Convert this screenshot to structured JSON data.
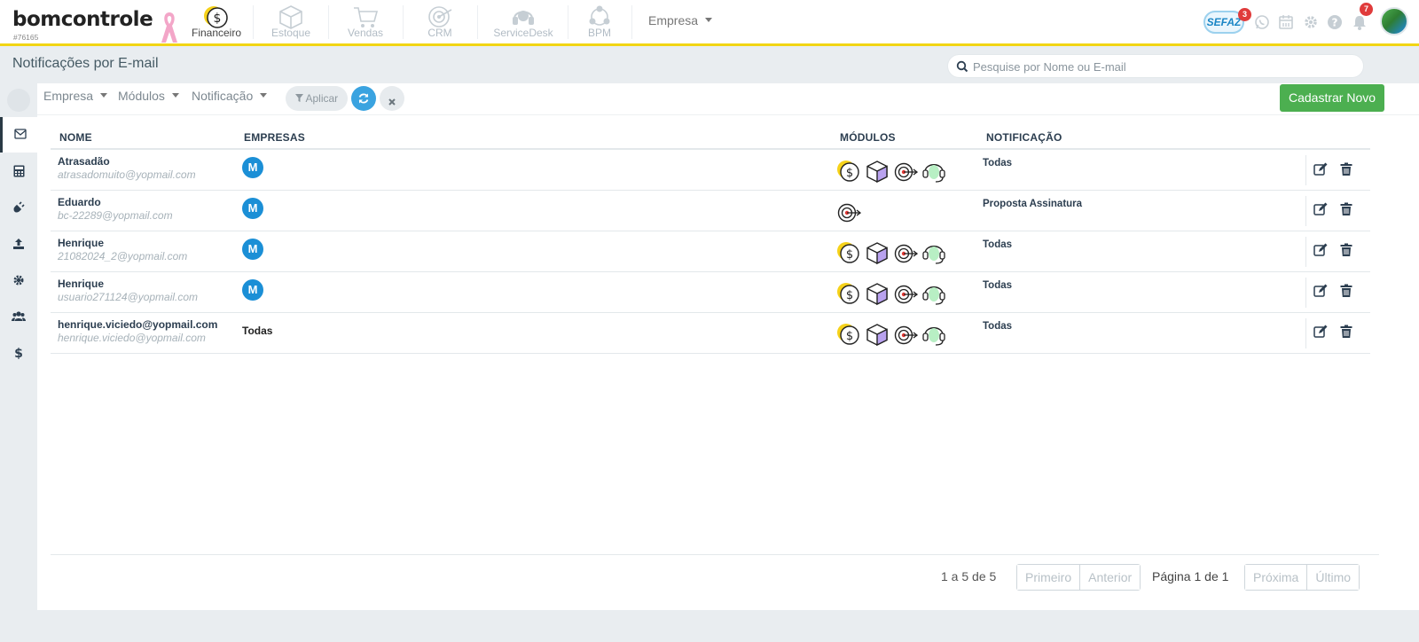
{
  "app": {
    "logo_text": "bomcontrole",
    "account_id": "#76165"
  },
  "topnav": {
    "modules": [
      {
        "label": "Financeiro",
        "icon": "coin-dollar-icon",
        "active": true
      },
      {
        "label": "Estoque",
        "icon": "box-icon",
        "active": false
      },
      {
        "label": "Vendas",
        "icon": "cart-icon",
        "active": false
      },
      {
        "label": "CRM",
        "icon": "target-icon",
        "active": false
      },
      {
        "label": "ServiceDesk",
        "icon": "headset-icon",
        "active": false
      },
      {
        "label": "BPM",
        "icon": "process-icon",
        "active": false
      }
    ],
    "empresa_label": "Empresa",
    "sefaz_label": "SEFAZ",
    "sefaz_badge": "3",
    "notifications_badge": "7"
  },
  "page": {
    "title": "Notificações por E-mail",
    "search_placeholder": "Pesquise por Nome ou E-mail"
  },
  "filters": {
    "empresa": "Empresa",
    "modulos": "Módulos",
    "notificacao": "Notificação",
    "apply_label": "Aplicar",
    "new_label": "Cadastrar Novo"
  },
  "table": {
    "headers": {
      "nome": "NOME",
      "empresas": "EMPRESAS",
      "modulos": "MÓDULOS",
      "notificacao": "NOTIFICAÇÃO"
    },
    "rows": [
      {
        "nome": "Atrasadão",
        "email": "atrasadomuito@yopmail.com",
        "empresa": "M",
        "modulos": [
          "financeiro",
          "estoque",
          "crm",
          "servicedesk"
        ],
        "notificacao": "Todas"
      },
      {
        "nome": "Eduardo",
        "email": "bc-22289@yopmail.com",
        "empresa": "M",
        "modulos": [
          "crm"
        ],
        "notificacao": "Proposta Assinatura"
      },
      {
        "nome": "Henrique",
        "email": "21082024_2@yopmail.com",
        "empresa": "M",
        "modulos": [
          "financeiro",
          "estoque",
          "crm",
          "servicedesk"
        ],
        "notificacao": "Todas"
      },
      {
        "nome": "Henrique",
        "email": "usuario271124@yopmail.com",
        "empresa": "M",
        "modulos": [
          "financeiro",
          "estoque",
          "crm",
          "servicedesk"
        ],
        "notificacao": "Todas"
      },
      {
        "nome": "henrique.viciedo@yopmail.com",
        "email": "henrique.viciedo@yopmail.com",
        "empresa_text": "Todas",
        "modulos": [
          "financeiro",
          "estoque",
          "crm",
          "servicedesk"
        ],
        "notificacao": "Todas"
      }
    ]
  },
  "pagination": {
    "info": "1 a 5 de 5",
    "first": "Primeiro",
    "prev": "Anterior",
    "page_prefix": "Página ",
    "page_current": "1",
    "page_mid": " de ",
    "page_total": "1",
    "next": "Próxima",
    "last": "Último"
  },
  "colors": {
    "accent_yellow": "#f2d513",
    "primary_blue": "#1b8fd6",
    "success_green": "#4caf50"
  }
}
